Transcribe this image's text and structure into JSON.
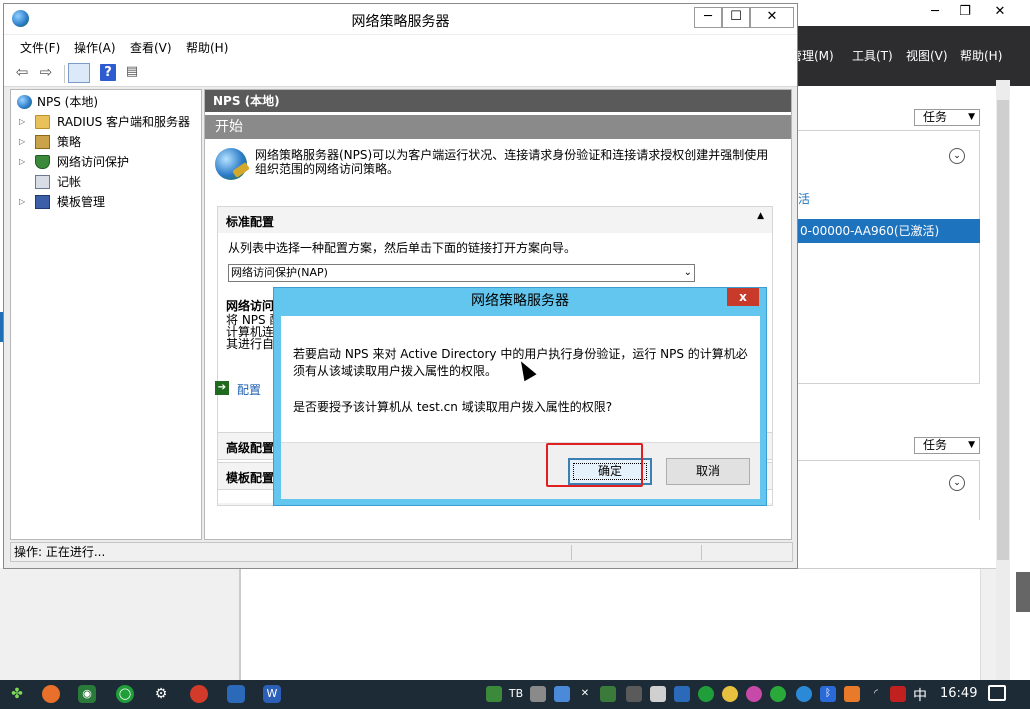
{
  "background_window": {
    "menu": [
      "管理(M)",
      "工具(T)",
      "视图(V)",
      "帮助(H)"
    ],
    "task_label": "任务",
    "task_label_2": "任务",
    "link_fragment": "活",
    "selected_row": "0-00000-AA960(已激活)"
  },
  "nps_window": {
    "title": "网络策略服务器",
    "menu": [
      "文件(F)",
      "操作(A)",
      "查看(V)",
      "帮助(H)"
    ],
    "tree": [
      {
        "label": "NPS (本地)",
        "expand": ""
      },
      {
        "label": "RADIUS 客户端和服务器",
        "expand": "▷"
      },
      {
        "label": "策略",
        "expand": "▷"
      },
      {
        "label": "网络访问保护",
        "expand": "▷"
      },
      {
        "label": "记帐",
        "expand": ""
      },
      {
        "label": "模板管理",
        "expand": "▷"
      }
    ],
    "pane_header": "NPS (本地)",
    "start_header": "开始",
    "intro_text": "网络策略服务器(NPS)可以为客户端运行状况、连接请求身份验证和连接请求授权创建并强制使用组织范围的网络访问策略。",
    "standard_config": {
      "title": "标准配置",
      "instruction": "从列表中选择一种配置方案，然后单击下面的链接打开方案向导。",
      "selected_option": "网络访问保护(NAP)",
      "frag_title": "网络访问",
      "frag_line1": "将 NPS 配",
      "frag_line2": "计算机连",
      "frag_line3": "其进行自",
      "config_link": "配置"
    },
    "advanced_config": "高级配置",
    "template_config": "模板配置",
    "status_text": "操作:  正在进行..."
  },
  "dialog": {
    "title": "网络策略服务器",
    "close": "x",
    "message_line1": "若要启动 NPS 来对 Active Directory 中的用户执行身份验证，运行 NPS 的计算机必须有从该域读取用户拨入属性的权限。",
    "message_line2": "是否要授予该计算机从 test.cn 域读取用户拨入属性的权限?",
    "ok_button": "确定",
    "cancel_button": "取消"
  },
  "taskbar": {
    "ime": "中",
    "clock": "16:49"
  }
}
